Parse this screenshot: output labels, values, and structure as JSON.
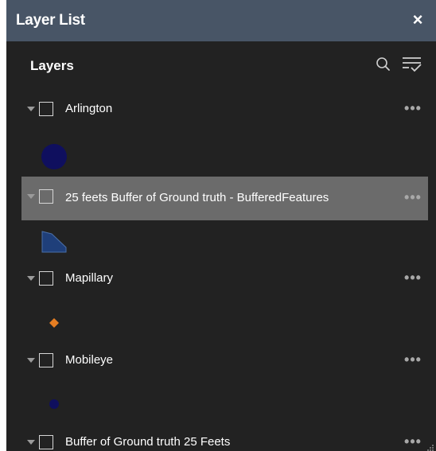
{
  "panel": {
    "title": "Layer List",
    "close_icon": "×",
    "section_label": "Layers",
    "search_icon": "search-icon",
    "filter_icon": "filter-list-icon"
  },
  "layers": [
    {
      "name": "Arlington",
      "more": "•••",
      "selected": false,
      "symbol": "circle",
      "symbol_color": "#0f0f5e"
    },
    {
      "name": "25 feets Buffer of Ground truth - BufferedFeatures",
      "more": "•••",
      "selected": true,
      "symbol": "polygon",
      "symbol_color": "#1f3f7a"
    },
    {
      "name": "Mapillary",
      "more": "•••",
      "selected": false,
      "symbol": "diamond",
      "symbol_color": "#e67e22"
    },
    {
      "name": "Mobileye",
      "more": "•••",
      "selected": false,
      "symbol": "dot",
      "symbol_color": "#0f0f5e"
    },
    {
      "name": "Buffer of Ground truth 25 Feets",
      "more": "•••",
      "selected": false,
      "symbol": "none",
      "symbol_color": ""
    }
  ],
  "colors": {
    "panel_bg": "#222222",
    "header_bg": "#485566",
    "selected_row": "#6b6b6b",
    "text": "#ffffff"
  }
}
